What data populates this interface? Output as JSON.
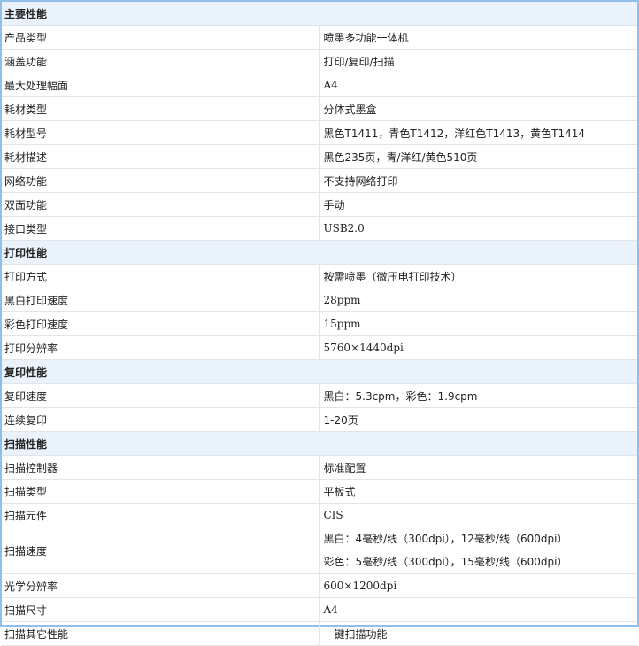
{
  "sections": [
    {
      "title": "主要性能",
      "rows": [
        {
          "label": "产品类型",
          "value": "喷墨多功能一体机"
        },
        {
          "label": "涵盖功能",
          "value": "打印/复印/扫描"
        },
        {
          "label": "最大处理幅面",
          "value": "A4"
        },
        {
          "label": "耗材类型",
          "value": "分体式墨盒"
        },
        {
          "label": "耗材型号",
          "value": "黑色T1411，青色T1412，洋红色T1413，黄色T1414"
        },
        {
          "label": "耗材描述",
          "value": "黑色235页，青/洋红/黄色510页"
        },
        {
          "label": "网络功能",
          "value": "不支持网络打印"
        },
        {
          "label": "双面功能",
          "value": "手动"
        },
        {
          "label": "接口类型",
          "value": "USB2.0"
        }
      ]
    },
    {
      "title": "打印性能",
      "rows": [
        {
          "label": "打印方式",
          "value": "按需喷墨（微压电打印技术）"
        },
        {
          "label": "黑白打印速度",
          "value": "28ppm"
        },
        {
          "label": "彩色打印速度",
          "value": "15ppm"
        },
        {
          "label": "打印分辨率",
          "value": "5760×1440dpi"
        }
      ]
    },
    {
      "title": "复印性能",
      "rows": [
        {
          "label": "复印速度",
          "value": "黑白：5.3cpm，彩色：1.9cpm"
        },
        {
          "label": "连续复印",
          "value": "1-20页"
        }
      ]
    },
    {
      "title": "扫描性能",
      "rows": [
        {
          "label": "扫描控制器",
          "value": "标准配置"
        },
        {
          "label": "扫描类型",
          "value": "平板式"
        },
        {
          "label": "扫描元件",
          "value": "CIS"
        },
        {
          "label": "扫描速度",
          "value": "黑白：4毫秒/线（300dpi），12毫秒/线（600dpi）",
          "value2": "彩色：5毫秒/线（300dpi），15毫秒/线（600dpi）"
        },
        {
          "label": "光学分辨率",
          "value": "600×1200dpi"
        },
        {
          "label": "扫描尺寸",
          "value": "A4"
        },
        {
          "label": "扫描其它性能",
          "value": "一键扫描功能"
        }
      ]
    }
  ]
}
